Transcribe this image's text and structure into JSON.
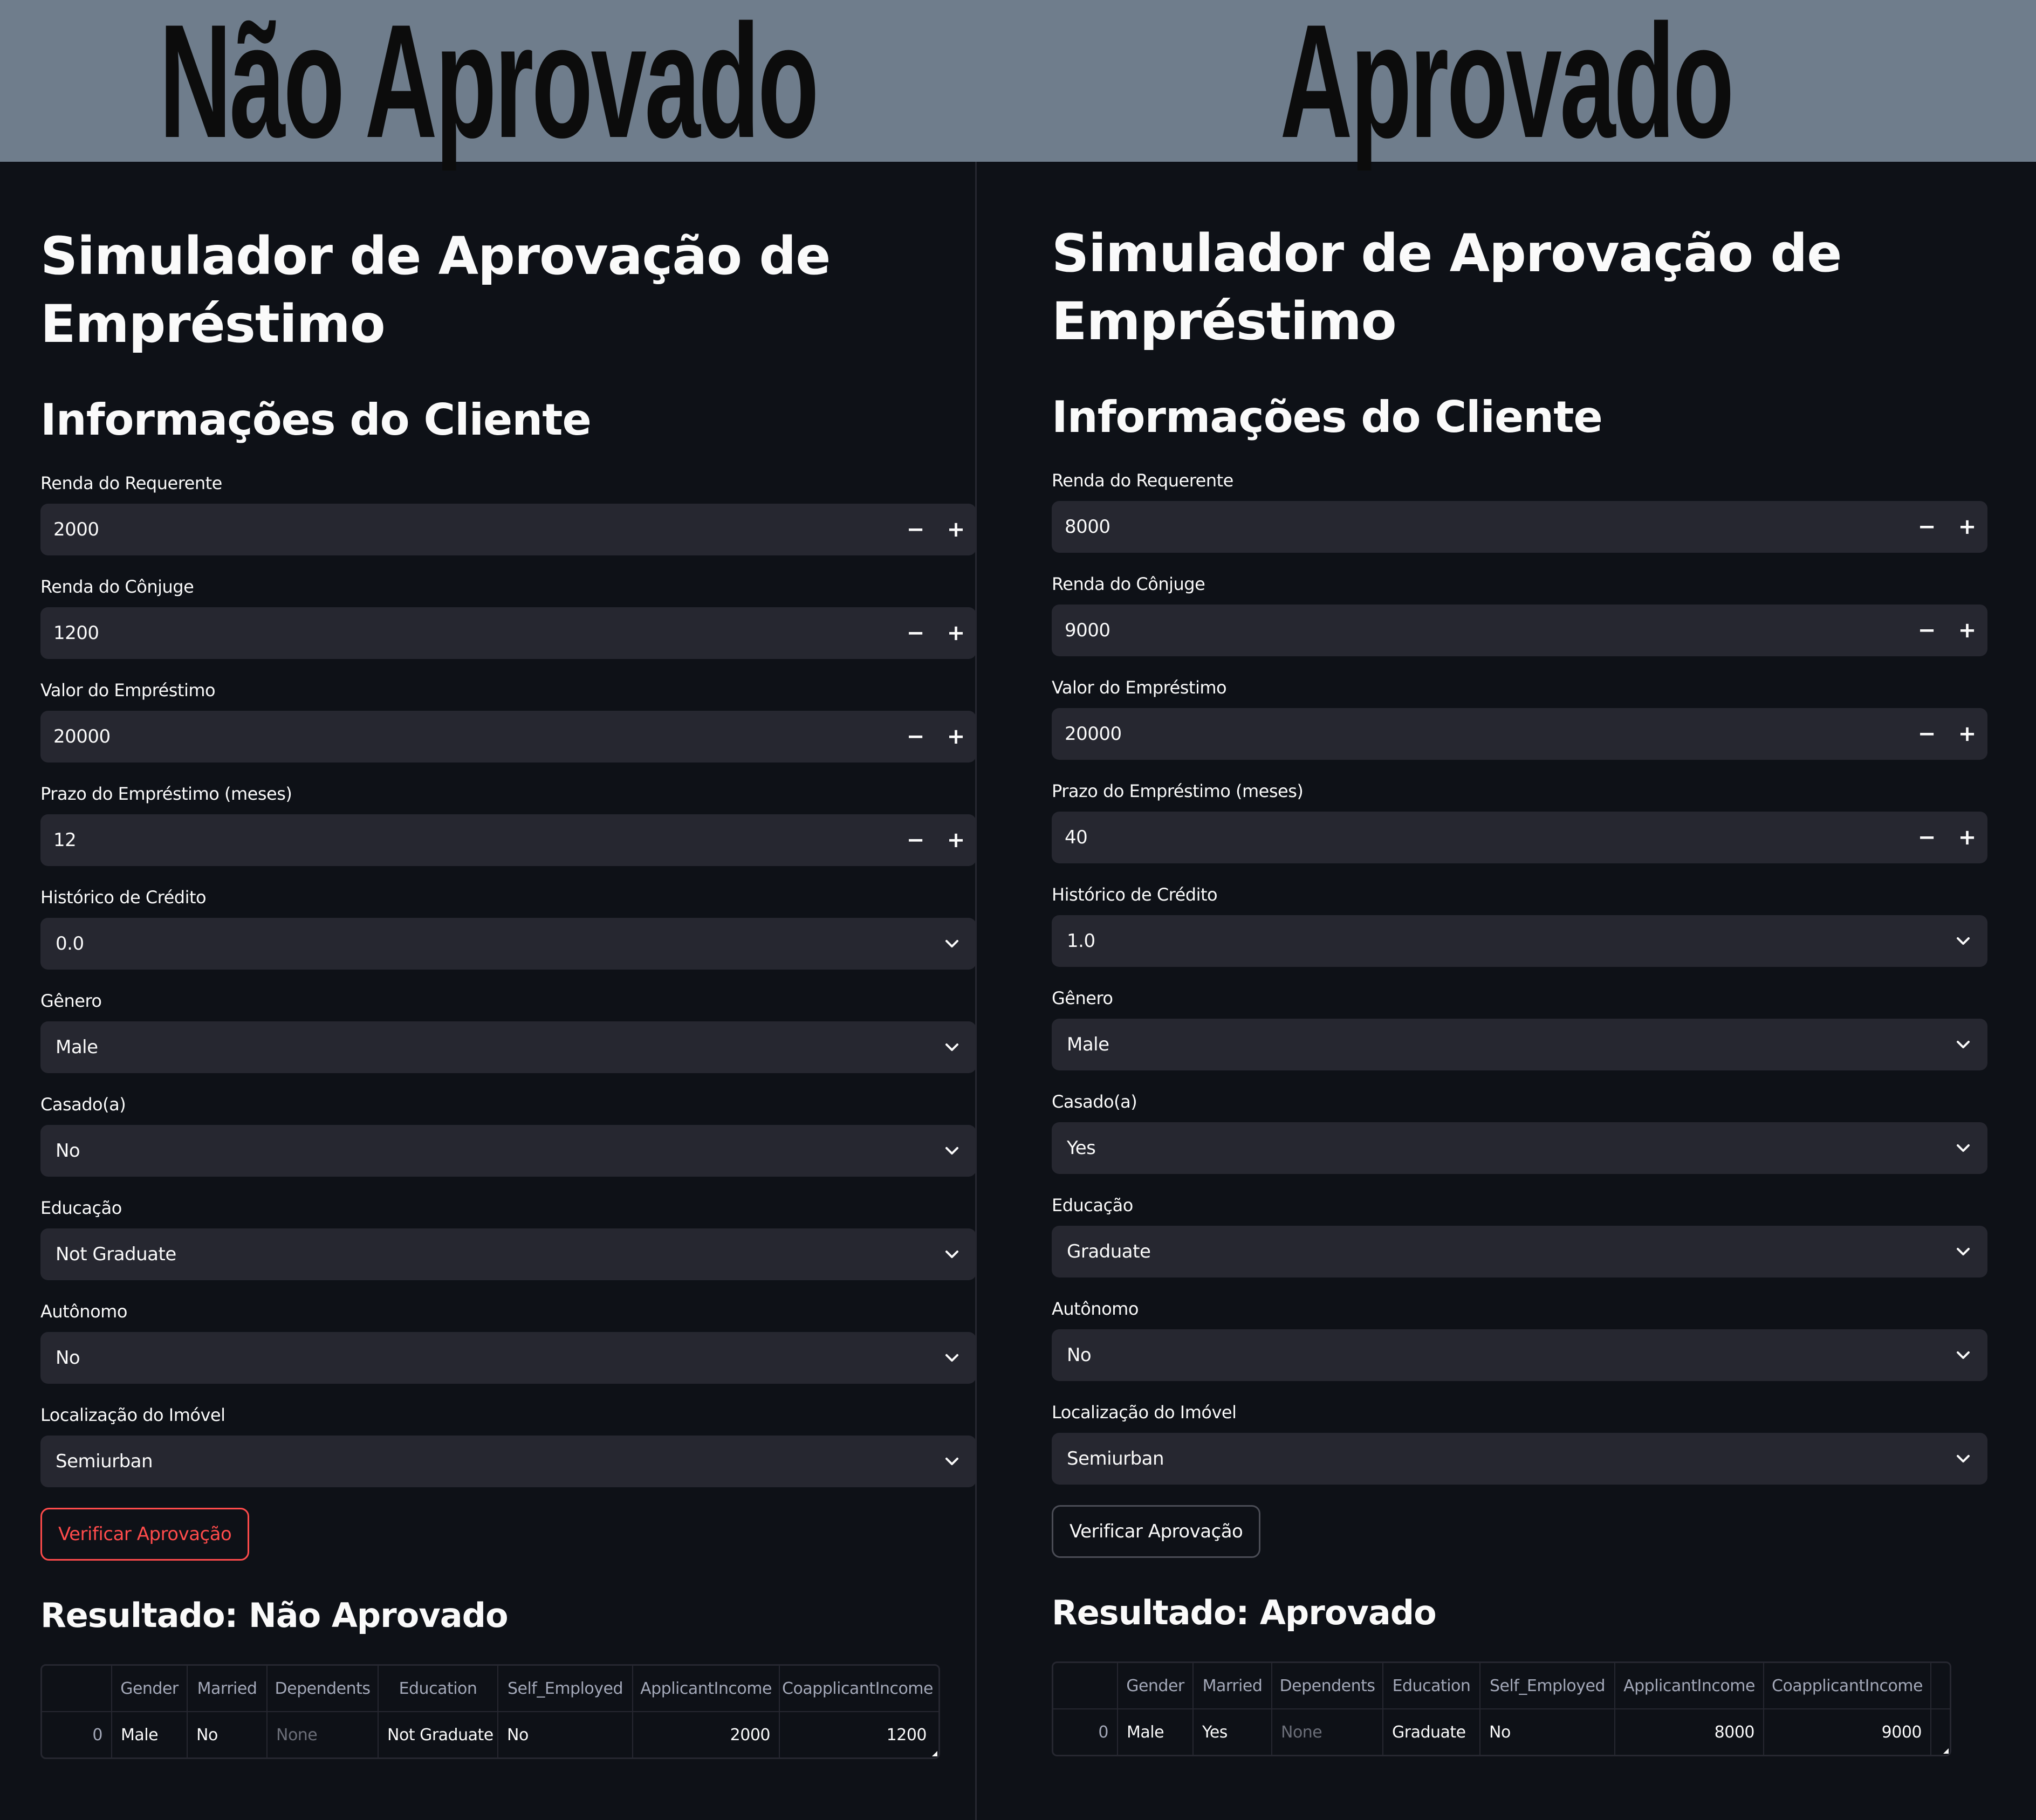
{
  "banner": {
    "left_label": "Não Aprovado",
    "right_label": "Aprovado"
  },
  "table_columns": [
    "",
    "Gender",
    "Married",
    "Dependents",
    "Education",
    "Self_Employed",
    "ApplicantIncome",
    "CoapplicantIncome"
  ],
  "panels": [
    {
      "title": "Simulador de Aprovação de Empréstimo",
      "section": "Informações do Cliente",
      "fields": [
        {
          "label": "Renda do Requerente",
          "value": "2000",
          "type": "number"
        },
        {
          "label": "Renda do Cônjuge",
          "value": "1200",
          "type": "number"
        },
        {
          "label": "Valor do Empréstimo",
          "value": "20000",
          "type": "number"
        },
        {
          "label": "Prazo do Empréstimo (meses)",
          "value": "12",
          "type": "number"
        },
        {
          "label": "Histórico de Crédito",
          "value": "0.0",
          "type": "select"
        },
        {
          "label": "Gênero",
          "value": "Male",
          "type": "select"
        },
        {
          "label": "Casado(a)",
          "value": "No",
          "type": "select"
        },
        {
          "label": "Educação",
          "value": "Not Graduate",
          "type": "select"
        },
        {
          "label": "Autônomo",
          "value": "No",
          "type": "select"
        },
        {
          "label": "Localização do Imóvel",
          "value": "Semiurban",
          "type": "select"
        }
      ],
      "button": "Verificar Aprovação",
      "result": "Resultado: Não Aprovado",
      "row": [
        "0",
        "Male",
        "No",
        "None",
        "Not Graduate",
        "No",
        "2000",
        "1200"
      ]
    },
    {
      "title": "Simulador de Aprovação de Empréstimo",
      "section": "Informações do Cliente",
      "fields": [
        {
          "label": "Renda do Requerente",
          "value": "8000",
          "type": "number"
        },
        {
          "label": "Renda do Cônjuge",
          "value": "9000",
          "type": "number"
        },
        {
          "label": "Valor do Empréstimo",
          "value": "20000",
          "type": "number"
        },
        {
          "label": "Prazo do Empréstimo (meses)",
          "value": "40",
          "type": "number"
        },
        {
          "label": "Histórico de Crédito",
          "value": "1.0",
          "type": "select"
        },
        {
          "label": "Gênero",
          "value": "Male",
          "type": "select"
        },
        {
          "label": "Casado(a)",
          "value": "Yes",
          "type": "select"
        },
        {
          "label": "Educação",
          "value": "Graduate",
          "type": "select"
        },
        {
          "label": "Autônomo",
          "value": "No",
          "type": "select"
        },
        {
          "label": "Localização do Imóvel",
          "value": "Semiurban",
          "type": "select"
        }
      ],
      "button": "Verificar Aprovação",
      "result": "Resultado: Aprovado",
      "row": [
        "0",
        "Male",
        "Yes",
        "None",
        "Graduate",
        "No",
        "8000",
        "9000"
      ]
    }
  ]
}
